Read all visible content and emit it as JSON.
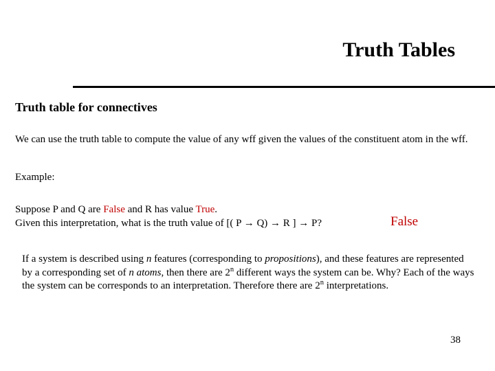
{
  "title": "Truth Tables",
  "section_heading": "Truth table for connectives",
  "intro": "We can use the truth table to compute the value of any wff given the values of the constituent atom in the wff.",
  "example_label": "Example:",
  "suppose": {
    "prefix": "Suppose P and Q are ",
    "false_word": "False",
    "mid1": " and R has value ",
    "true_word": "True",
    "period": ".",
    "line2_prefix": "Given this interpretation, what is the truth value of [( P ",
    "arrow": "→",
    "line2_mid1": " Q) ",
    "line2_mid2": " R ] ",
    "line2_suffix": " P?"
  },
  "answer": "False",
  "para": {
    "t1": "If a system is described using ",
    "n": "n",
    "t2": " features (corresponding to ",
    "propositions": "propositions",
    "t3": "), and these features are represented  by a corresponding set of ",
    "t4": " atoms",
    "t5": ", then there are 2",
    "sup_n": "n",
    "t6": " different ways the system can be. Why?  Each of the ways the system can be corresponds to an interpretation. Therefore there are 2",
    "t7": " interpretations."
  },
  "page": "38"
}
